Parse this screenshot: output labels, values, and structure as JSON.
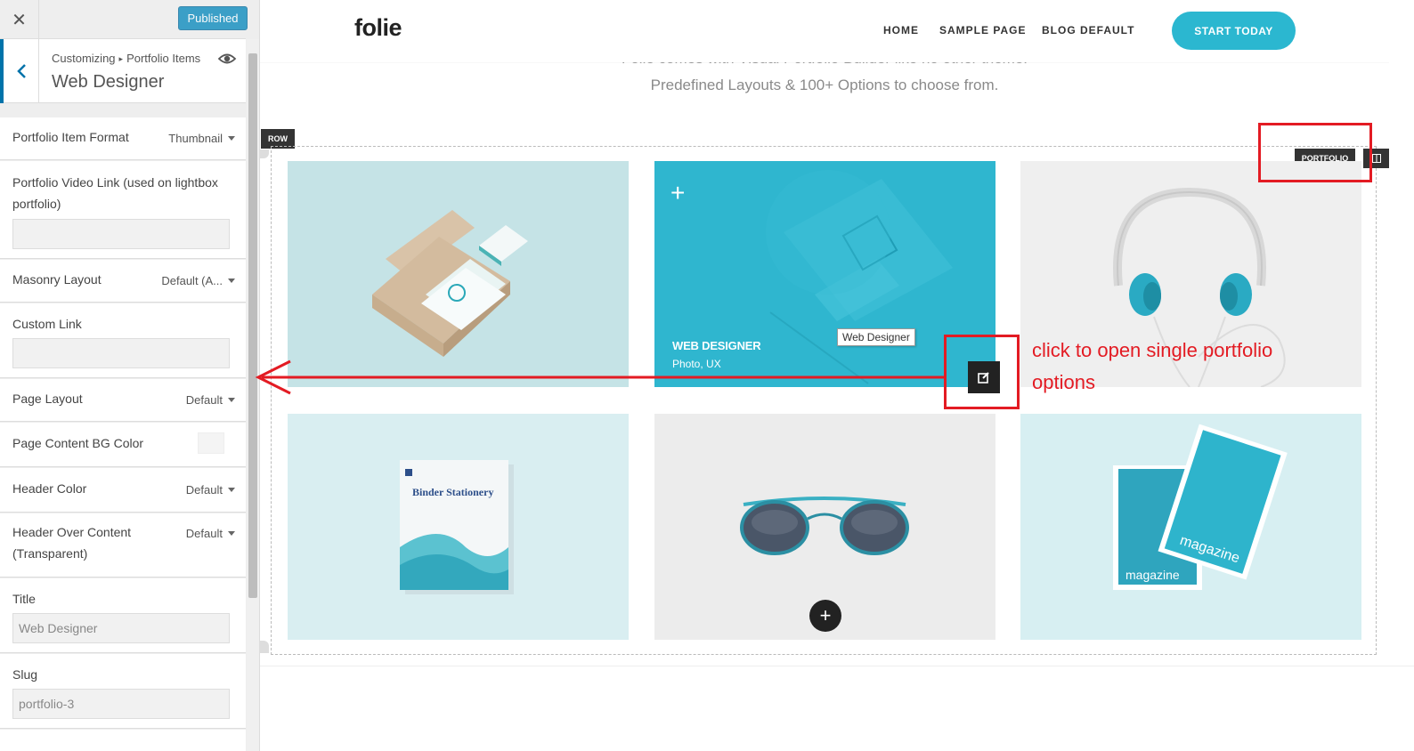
{
  "topbar": {
    "close_icon": "close-icon",
    "publish_label": "Published"
  },
  "panel": {
    "breadcrumb_root": "Customizing",
    "breadcrumb_section": "Portfolio Items",
    "title": "Web Designer"
  },
  "controls": {
    "format_label": "Portfolio Item Format",
    "format_value": "Thumbnail",
    "video_label": "Portfolio Video Link (used on lightbox portfolio)",
    "video_value": "",
    "masonry_label": "Masonry Layout",
    "masonry_value": "Default (A...",
    "custom_link_label": "Custom Link",
    "custom_link_value": "",
    "page_layout_label": "Page Layout",
    "page_layout_value": "Default",
    "bg_color_label": "Page Content BG Color",
    "bg_color_value": "#f4f4f4",
    "header_color_label": "Header Color",
    "header_color_value": "Default",
    "header_over_label": "Header Over Content (Transparent)",
    "header_over_value": "Default",
    "title_label": "Title",
    "title_value": "Web Designer",
    "slug_label": "Slug",
    "slug_value": "portfolio-3"
  },
  "site": {
    "logo": "folie",
    "nav": [
      "HOME",
      "SAMPLE PAGE",
      "BLOG DEFAULT"
    ],
    "cta": "START TODAY",
    "intro_line1": "Folie comes with Visual Portfolio Builder like no other theme.",
    "intro_line2": "Predefined Layouts & 100+ Options to choose from."
  },
  "builder": {
    "row_tag": "ROW",
    "portfolio_tag": "PORTFOLIO"
  },
  "portfolio": {
    "hover_title": "WEB DESIGNER",
    "hover_categories": "Photo, UX",
    "tooltip": "Web Designer",
    "book_title": "Binder Stationery",
    "magazine_text": "magazine"
  },
  "annotation": {
    "text": "click to open single portfolio options"
  },
  "colors": {
    "accent": "#2bb7d0",
    "wp_blue": "#0085ba",
    "annotation_red": "#e31b23"
  }
}
